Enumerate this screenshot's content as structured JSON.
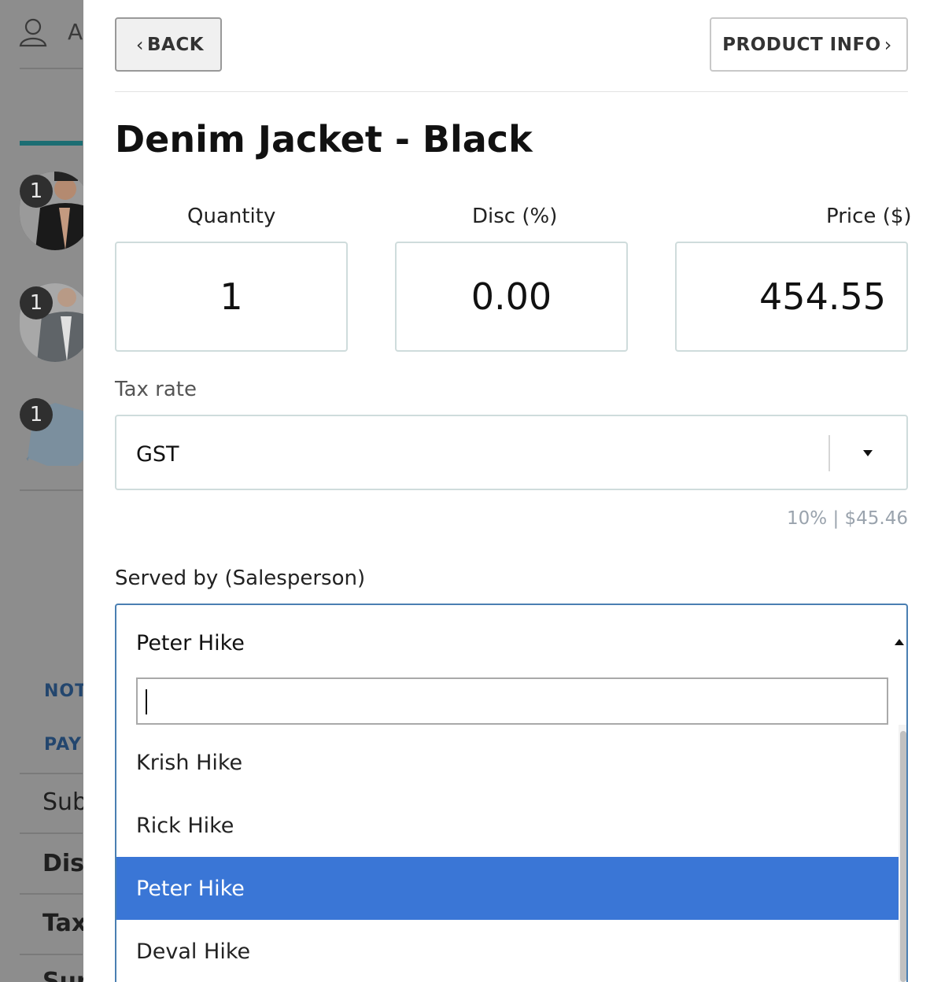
{
  "background": {
    "user_label": "A",
    "cart_items": [
      {
        "quantity": "1"
      },
      {
        "quantity": "1"
      },
      {
        "quantity": "1"
      }
    ],
    "links": [
      "NOT",
      "PAYM"
    ],
    "summary_rows": [
      "Sub",
      "Disc",
      "Tax",
      "Sur"
    ]
  },
  "drawer": {
    "back_label": "BACK",
    "product_info_label": "PRODUCT INFO",
    "product_title": "Denim Jacket - Black",
    "quantity": {
      "label": "Quantity",
      "value": "1"
    },
    "discount": {
      "label": "Disc (%)",
      "value": "0.00"
    },
    "price": {
      "label": "Price ($)",
      "value": "454.55"
    },
    "tax": {
      "label": "Tax rate",
      "selected": "GST",
      "info": "10% | $45.46"
    },
    "salesperson": {
      "label": "Served by (Salesperson)",
      "selected": "Peter Hike",
      "search_value": "",
      "options": [
        "Krish Hike",
        "Rick Hike",
        "Peter Hike",
        "Deval Hike"
      ],
      "highlighted": "Peter Hike"
    }
  }
}
